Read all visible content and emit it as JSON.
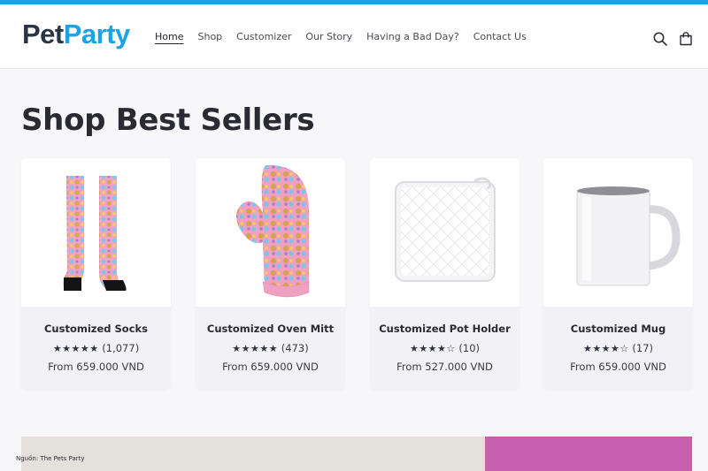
{
  "brand": {
    "logo_part1": "Pet",
    "logo_part2": "Party",
    "accent": "#1ba3e6"
  },
  "nav": {
    "items": [
      {
        "label": "Home",
        "active": true
      },
      {
        "label": "Shop"
      },
      {
        "label": "Customizer"
      },
      {
        "label": "Our Story"
      },
      {
        "label": "Having a Bad Day?"
      },
      {
        "label": "Contact Us"
      }
    ]
  },
  "header_icons": [
    "search-icon",
    "cart-icon"
  ],
  "section": {
    "title": "Shop Best Sellers"
  },
  "products": [
    {
      "name": "Customized Socks",
      "stars": "★★★★★",
      "reviews": "(1,077)",
      "price": "From 659.000 VND",
      "rating": 5
    },
    {
      "name": "Customized Oven Mitt",
      "stars": "★★★★★",
      "reviews": "(473)",
      "price": "From 659.000 VND",
      "rating": 5
    },
    {
      "name": "Customized Pot Holder",
      "stars": "★★★★☆",
      "reviews": "(10)",
      "price": "From 527.000 VND",
      "rating": 4.5
    },
    {
      "name": "Customized Mug",
      "stars": "★★★★☆",
      "reviews": "(17)",
      "price": "From 659.000 VND",
      "rating": 4.5
    }
  ],
  "source_note": "Nguồn: The Pets Party"
}
